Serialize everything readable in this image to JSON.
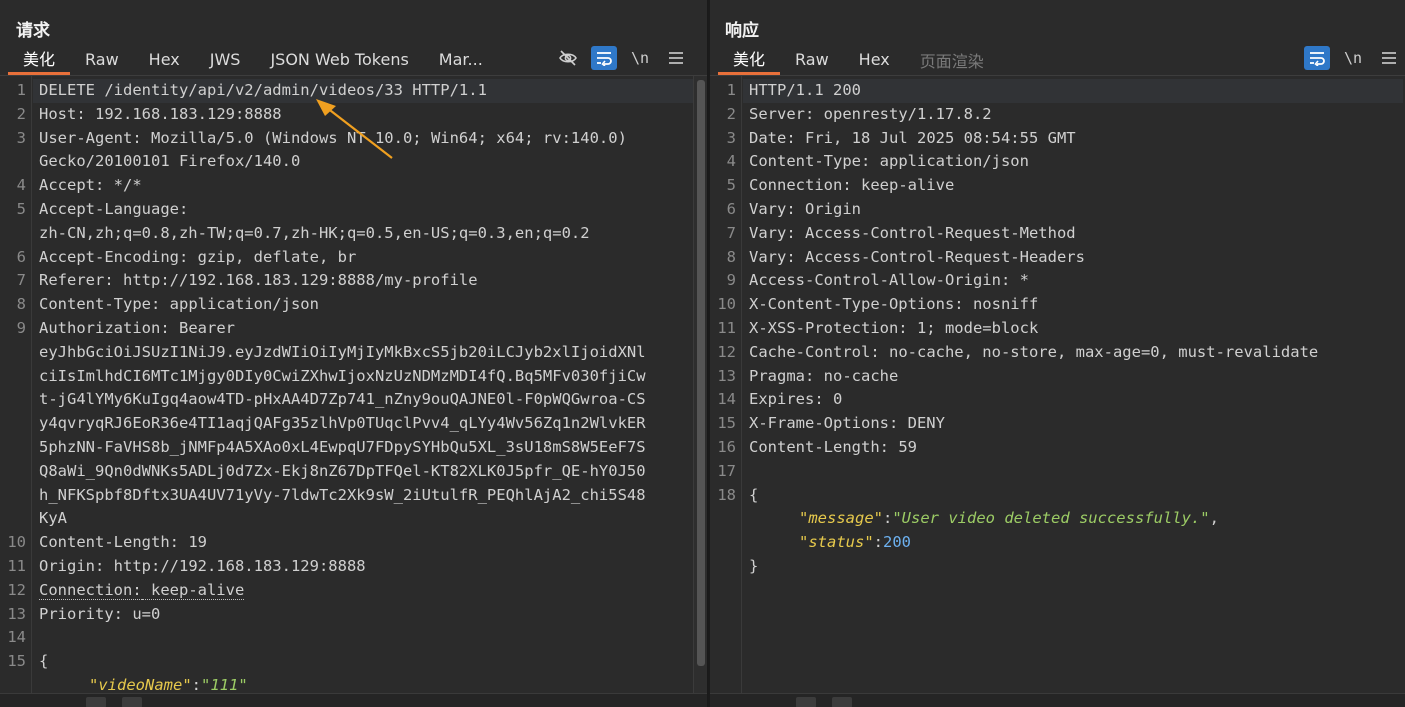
{
  "request": {
    "title": "请求",
    "tabs": [
      "美化",
      "Raw",
      "Hex",
      "JWS",
      "JSON Web Tokens",
      "Mar..."
    ],
    "toolbar": {
      "hide_icon": "eye-slash-icon",
      "wrap_icon": "wrap-icon",
      "newline_label": "\\n",
      "menu_icon": "hamburger-icon"
    },
    "lines": [
      {
        "n": "1",
        "k": "DELETE /identity/api/v2/admin/videos/33 HTTP/1.1",
        "v": ""
      },
      {
        "n": "2",
        "k": "Host:",
        "v": " 192.168.183.129:8888"
      },
      {
        "n": "3",
        "k": "User-Agent:",
        "v": " Mozilla/5.0 (Windows NT 10.0; Win64; x64; rv:140.0)"
      },
      {
        "n": "",
        "k": "",
        "v": "Gecko/20100101 Firefox/140.0"
      },
      {
        "n": "4",
        "k": "Accept:",
        "v": " */*"
      },
      {
        "n": "5",
        "k": "Accept-Language:",
        "v": ""
      },
      {
        "n": "",
        "k": "",
        "v": "zh-CN,zh;q=0.8,zh-TW;q=0.7,zh-HK;q=0.5,en-US;q=0.3,en;q=0.2"
      },
      {
        "n": "6",
        "k": "Accept-Encoding:",
        "v": " gzip, deflate, br"
      },
      {
        "n": "7",
        "k": "Referer:",
        "v": " http://192.168.183.129:8888/my-profile"
      },
      {
        "n": "8",
        "k": "Content-Type:",
        "v": " application/json"
      },
      {
        "n": "9",
        "k": "Authorization:",
        "v": " Bearer"
      },
      {
        "n": "",
        "k": "",
        "v": "eyJhbGciOiJSUzI1NiJ9.eyJzdWIiOiIyMjIyMkBxcS5jb20iLCJyb2xlIjoidXNl"
      },
      {
        "n": "",
        "k": "",
        "v": "ciIsImlhdCI6MTc1Mjgy0DIy0CwiZXhwIjoxNzUzNDMzMDI4fQ.Bq5MFv030fjiCw"
      },
      {
        "n": "",
        "k": "",
        "v": "t-jG4lYMy6KuIgq4aow4TD-pHxAA4D7Zp741_nZny9ouQAJNE0l-F0pWQGwroa-CS"
      },
      {
        "n": "",
        "k": "",
        "v": "y4qvryqRJ6EoR36e4TI1aqjQAFg35zlhVp0TUqclPvv4_qLYy4Wv56Zq1n2WlvkER"
      },
      {
        "n": "",
        "k": "",
        "v": "5phzNN-FaVHS8b_jNMFp4A5XAo0xL4EwpqU7FDpySYHbQu5XL_3sU18mS8W5EeF7S"
      },
      {
        "n": "",
        "k": "",
        "v": "Q8aWi_9Qn0dWNKs5ADLj0d7Zx-Ekj8nZ67DpTFQel-KT82XLK0J5pfr_QE-hY0J50"
      },
      {
        "n": "",
        "k": "",
        "v": "h_NFKSpbf8Dftx3UA4UV71yVy-7ldwTc2Xk9sW_2iUtulfR_PEQhlAjA2_chi5S48"
      },
      {
        "n": "",
        "k": "",
        "v": "KyA"
      },
      {
        "n": "10",
        "k": "Content-Length:",
        "v": " 19"
      },
      {
        "n": "11",
        "k": "Origin:",
        "v": " http://192.168.183.129:8888"
      },
      {
        "n": "12",
        "k": "Connection:",
        "v": " keep-alive"
      },
      {
        "n": "13",
        "k": "Priority:",
        "v": " u=0"
      },
      {
        "n": "14",
        "k": "",
        "v": ""
      },
      {
        "n": "15",
        "k": "{",
        "v": ""
      }
    ],
    "json_line": {
      "key": "\"videoName\"",
      "sep": ":",
      "val": "\"111\""
    }
  },
  "response": {
    "title": "响应",
    "tabs": [
      "美化",
      "Raw",
      "Hex",
      "页面渲染"
    ],
    "toolbar": {
      "wrap_icon": "wrap-icon",
      "newline_label": "\\n",
      "menu_icon": "hamburger-icon"
    },
    "lines": [
      {
        "n": "1",
        "k": "HTTP/1.1 200",
        "v": ""
      },
      {
        "n": "2",
        "k": "Server:",
        "v": " openresty/1.17.8.2"
      },
      {
        "n": "3",
        "k": "Date:",
        "v": " Fri, 18 Jul 2025 08:54:55 GMT"
      },
      {
        "n": "4",
        "k": "Content-Type:",
        "v": " application/json"
      },
      {
        "n": "5",
        "k": "Connection:",
        "v": " keep-alive"
      },
      {
        "n": "6",
        "k": "Vary:",
        "v": " Origin"
      },
      {
        "n": "7",
        "k": "Vary:",
        "v": " Access-Control-Request-Method"
      },
      {
        "n": "8",
        "k": "Vary:",
        "v": " Access-Control-Request-Headers"
      },
      {
        "n": "9",
        "k": "Access-Control-Allow-Origin:",
        "v": " *"
      },
      {
        "n": "10",
        "k": "X-Content-Type-Options:",
        "v": " nosniff"
      },
      {
        "n": "11",
        "k": "X-XSS-Protection:",
        "v": " 1; mode=block"
      },
      {
        "n": "12",
        "k": "Cache-Control:",
        "v": " no-cache, no-store, max-age=0, must-revalidate"
      },
      {
        "n": "13",
        "k": "Pragma:",
        "v": " no-cache"
      },
      {
        "n": "14",
        "k": "Expires:",
        "v": " 0"
      },
      {
        "n": "15",
        "k": "X-Frame-Options:",
        "v": " DENY"
      },
      {
        "n": "16",
        "k": "Content-Length:",
        "v": " 59"
      },
      {
        "n": "17",
        "k": "",
        "v": ""
      },
      {
        "n": "18",
        "k": "{",
        "v": ""
      }
    ],
    "json": [
      {
        "key": "\"message\"",
        "sep": ":",
        "val": "\"User video deleted successfully.\"",
        "tail": ",",
        "type": "str"
      },
      {
        "key": "\"status\"",
        "sep": ":",
        "val": "200",
        "tail": "",
        "type": "num"
      }
    ],
    "close": "}"
  },
  "colors": {
    "accent_tab": "#e8703a",
    "toggle_on": "#2f78c8",
    "json_key": "#e6c94c",
    "json_string": "#9ccc65",
    "json_number": "#6db1f0",
    "arrow": "#f0a020"
  }
}
